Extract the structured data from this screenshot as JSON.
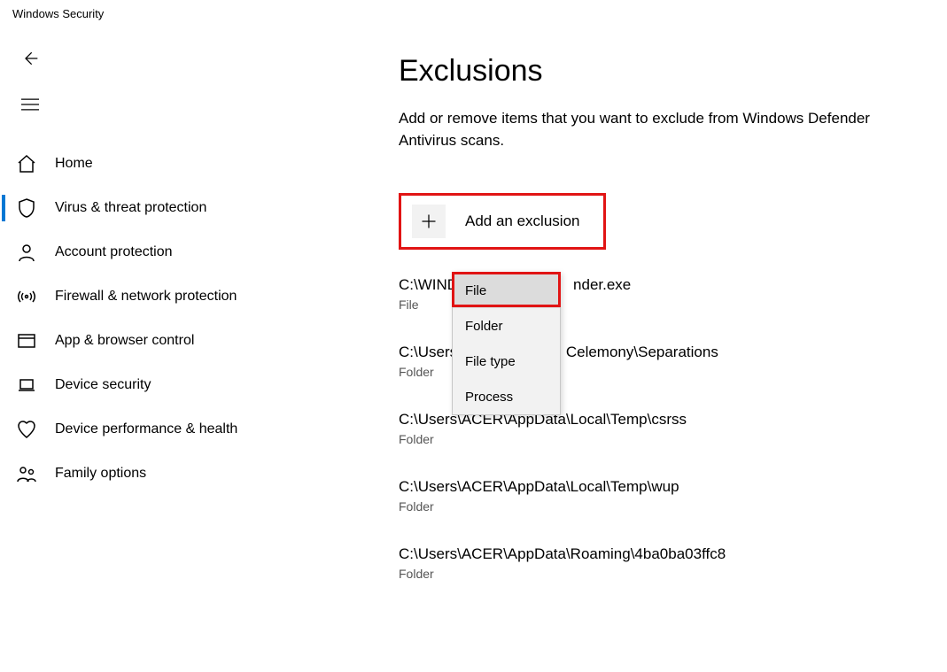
{
  "app_title": "Windows Security",
  "sidebar": {
    "items": [
      {
        "key": "home",
        "label": "Home"
      },
      {
        "key": "virus-threat",
        "label": "Virus & threat protection"
      },
      {
        "key": "account",
        "label": "Account protection"
      },
      {
        "key": "firewall",
        "label": "Firewall & network protection"
      },
      {
        "key": "app-browser",
        "label": "App & browser control"
      },
      {
        "key": "device-security",
        "label": "Device security"
      },
      {
        "key": "device-perf",
        "label": "Device performance & health"
      },
      {
        "key": "family",
        "label": "Family options"
      }
    ],
    "selected_key": "virus-threat"
  },
  "page": {
    "title": "Exclusions",
    "subtitle": "Add or remove items that you want to exclude from Windows Defender Antivirus scans.",
    "add_button_label": "Add an exclusion"
  },
  "dropdown": {
    "items": [
      {
        "label": "File"
      },
      {
        "label": "Folder"
      },
      {
        "label": "File type"
      },
      {
        "label": "Process"
      }
    ]
  },
  "exclusions": [
    {
      "path_left": "C:\\WIND",
      "path_right": "nder.exe",
      "type": "File"
    },
    {
      "path_left": "C:\\Users\\",
      "path_right": "Celemony\\Separations",
      "type": "Folder"
    },
    {
      "path_left": "C:\\Users\\ACER\\AppData\\Local\\Temp\\csrss",
      "path_right": "",
      "type": "Folder"
    },
    {
      "path_left": "C:\\Users\\ACER\\AppData\\Local\\Temp\\wup",
      "path_right": "",
      "type": "Folder"
    },
    {
      "path_left": "C:\\Users\\ACER\\AppData\\Roaming\\4ba0ba03ffc8",
      "path_right": "",
      "type": "Folder"
    }
  ]
}
